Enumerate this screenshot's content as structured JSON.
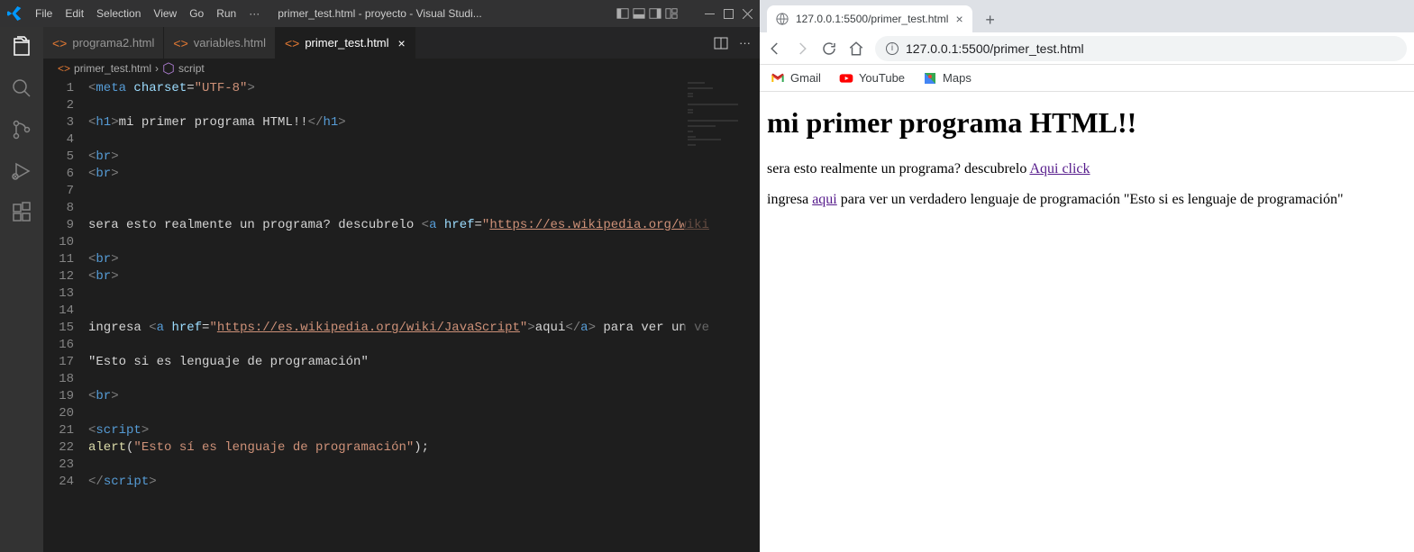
{
  "vscode": {
    "menu": [
      "File",
      "Edit",
      "Selection",
      "View",
      "Go",
      "Run",
      "···"
    ],
    "title": "primer_test.html - proyecto - Visual Studi...",
    "tabs": [
      {
        "label": "programa2.html",
        "active": false
      },
      {
        "label": "variables.html",
        "active": false
      },
      {
        "label": "primer_test.html",
        "active": true
      }
    ],
    "breadcrumb": {
      "file": "primer_test.html",
      "symbol": "script"
    },
    "code": {
      "lines": [
        {
          "n": 1,
          "tokens": [
            {
              "t": "<",
              "c": "tok-tag"
            },
            {
              "t": "meta ",
              "c": "tok-name"
            },
            {
              "t": "charset",
              "c": "tok-attr"
            },
            {
              "t": "=",
              "c": "tok-text"
            },
            {
              "t": "\"UTF-8\"",
              "c": "tok-str"
            },
            {
              "t": ">",
              "c": "tok-tag"
            }
          ]
        },
        {
          "n": 2,
          "tokens": []
        },
        {
          "n": 3,
          "tokens": [
            {
              "t": "<",
              "c": "tok-tag"
            },
            {
              "t": "h1",
              "c": "tok-name"
            },
            {
              "t": ">",
              "c": "tok-tag"
            },
            {
              "t": "mi primer programa HTML!!",
              "c": "tok-text"
            },
            {
              "t": "</",
              "c": "tok-tag"
            },
            {
              "t": "h1",
              "c": "tok-name"
            },
            {
              "t": ">",
              "c": "tok-tag"
            }
          ]
        },
        {
          "n": 4,
          "tokens": []
        },
        {
          "n": 5,
          "tokens": [
            {
              "t": "<",
              "c": "tok-tag"
            },
            {
              "t": "br",
              "c": "tok-name"
            },
            {
              "t": ">",
              "c": "tok-tag"
            }
          ]
        },
        {
          "n": 6,
          "tokens": [
            {
              "t": "<",
              "c": "tok-tag"
            },
            {
              "t": "br",
              "c": "tok-name"
            },
            {
              "t": ">",
              "c": "tok-tag"
            }
          ]
        },
        {
          "n": 7,
          "tokens": []
        },
        {
          "n": 8,
          "tokens": []
        },
        {
          "n": 9,
          "tokens": [
            {
              "t": "sera esto realmente un programa? descubrelo ",
              "c": "tok-text"
            },
            {
              "t": "<",
              "c": "tok-tag"
            },
            {
              "t": "a ",
              "c": "tok-name"
            },
            {
              "t": "href",
              "c": "tok-attr"
            },
            {
              "t": "=",
              "c": "tok-text"
            },
            {
              "t": "\"",
              "c": "tok-str"
            },
            {
              "t": "https://es.wikipedia.org/wiki",
              "c": "tok-url"
            }
          ]
        },
        {
          "n": 10,
          "tokens": []
        },
        {
          "n": 11,
          "tokens": [
            {
              "t": "<",
              "c": "tok-tag"
            },
            {
              "t": "br",
              "c": "tok-name"
            },
            {
              "t": ">",
              "c": "tok-tag"
            }
          ]
        },
        {
          "n": 12,
          "tokens": [
            {
              "t": "<",
              "c": "tok-tag"
            },
            {
              "t": "br",
              "c": "tok-name"
            },
            {
              "t": ">",
              "c": "tok-tag"
            }
          ]
        },
        {
          "n": 13,
          "tokens": []
        },
        {
          "n": 14,
          "tokens": []
        },
        {
          "n": 15,
          "tokens": [
            {
              "t": "ingresa ",
              "c": "tok-text"
            },
            {
              "t": "<",
              "c": "tok-tag"
            },
            {
              "t": "a ",
              "c": "tok-name"
            },
            {
              "t": "href",
              "c": "tok-attr"
            },
            {
              "t": "=",
              "c": "tok-text"
            },
            {
              "t": "\"",
              "c": "tok-str"
            },
            {
              "t": "https://es.wikipedia.org/wiki/JavaScript",
              "c": "tok-url"
            },
            {
              "t": "\"",
              "c": "tok-str"
            },
            {
              "t": ">",
              "c": "tok-tag"
            },
            {
              "t": "aqui",
              "c": "tok-text"
            },
            {
              "t": "</",
              "c": "tok-tag"
            },
            {
              "t": "a",
              "c": "tok-name"
            },
            {
              "t": ">",
              "c": "tok-tag"
            },
            {
              "t": " para ver un ve",
              "c": "tok-text"
            }
          ]
        },
        {
          "n": 16,
          "tokens": []
        },
        {
          "n": 17,
          "tokens": [
            {
              "t": "\"Esto si es lenguaje de programación\"",
              "c": "tok-text"
            }
          ]
        },
        {
          "n": 18,
          "tokens": []
        },
        {
          "n": 19,
          "tokens": [
            {
              "t": "<",
              "c": "tok-tag"
            },
            {
              "t": "br",
              "c": "tok-name"
            },
            {
              "t": ">",
              "c": "tok-tag"
            }
          ]
        },
        {
          "n": 20,
          "tokens": []
        },
        {
          "n": 21,
          "tokens": [
            {
              "t": "<",
              "c": "tok-tag"
            },
            {
              "t": "script",
              "c": "tok-name"
            },
            {
              "t": ">",
              "c": "tok-tag"
            }
          ]
        },
        {
          "n": 22,
          "tokens": [
            {
              "t": "alert",
              "c": "tok-func"
            },
            {
              "t": "(",
              "c": "tok-text"
            },
            {
              "t": "\"Esto sí es lenguaje de programación\"",
              "c": "tok-str"
            },
            {
              "t": ");",
              "c": "tok-text"
            }
          ]
        },
        {
          "n": 23,
          "tokens": []
        },
        {
          "n": 24,
          "tokens": [
            {
              "t": "</",
              "c": "tok-tag"
            },
            {
              "t": "script",
              "c": "tok-name"
            },
            {
              "t": ">",
              "c": "tok-tag"
            }
          ]
        }
      ]
    }
  },
  "browser": {
    "tab_title": "127.0.0.1:5500/primer_test.html",
    "url": "127.0.0.1:5500/primer_test.html",
    "bookmarks": [
      {
        "label": "Gmail",
        "icon": "gmail"
      },
      {
        "label": "YouTube",
        "icon": "youtube"
      },
      {
        "label": "Maps",
        "icon": "maps"
      }
    ],
    "page": {
      "h1": "mi primer programa HTML!!",
      "p1_pre": "sera esto realmente un programa? descubrelo ",
      "p1_link": "Aqui click",
      "p2_pre": "ingresa ",
      "p2_link": "aqui",
      "p2_post": " para ver un verdadero lenguaje de programación \"Esto si es lenguaje de programación\""
    }
  }
}
